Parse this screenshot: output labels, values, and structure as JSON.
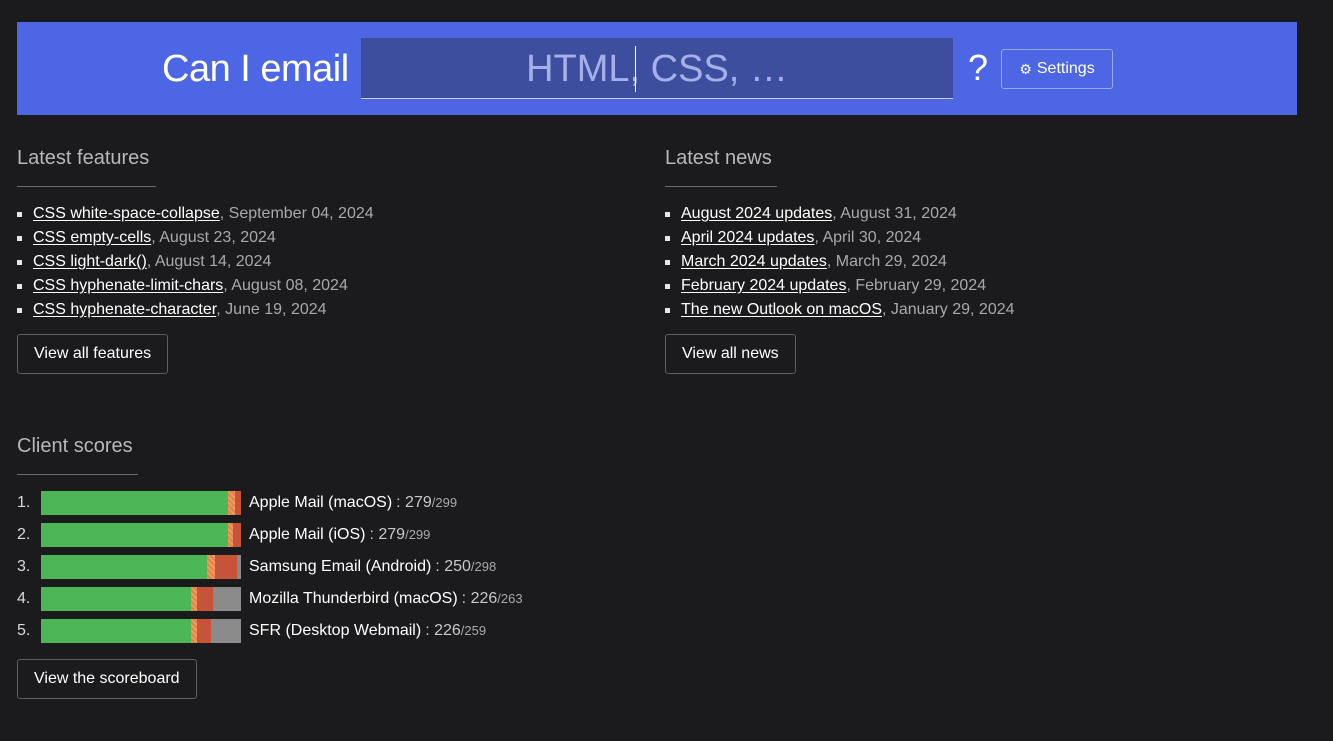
{
  "header": {
    "brand": "Can I email",
    "search_placeholder": "HTML, CSS, …",
    "help_label": "?",
    "settings_label": "Settings"
  },
  "latest_features": {
    "title": "Latest features",
    "items": [
      {
        "link": "CSS white-space-collapse",
        "date": ", September 04, 2024"
      },
      {
        "link": "CSS empty-cells",
        "date": ", August 23, 2024"
      },
      {
        "link": "CSS light-dark()",
        "date": ", August 14, 2024"
      },
      {
        "link": "CSS hyphenate-limit-chars",
        "date": ", August 08, 2024"
      },
      {
        "link": "CSS hyphenate-character",
        "date": ", June 19, 2024"
      }
    ],
    "button": "View all features"
  },
  "latest_news": {
    "title": "Latest news",
    "items": [
      {
        "link": "August 2024 updates",
        "date": ", August 31, 2024"
      },
      {
        "link": "April 2024 updates",
        "date": ", April 30, 2024"
      },
      {
        "link": "March 2024 updates",
        "date": ", March 29, 2024"
      },
      {
        "link": "February 2024 updates",
        "date": ", February 29, 2024"
      },
      {
        "link": "The new Outlook on macOS",
        "date": ", January 29, 2024"
      }
    ],
    "button": "View all news"
  },
  "client_scores": {
    "title": "Client scores",
    "colors": {
      "supported": "#4db657",
      "partial": "#e8a44d",
      "not_supported": "#c8533b",
      "unknown": "#8b8b8b"
    },
    "items": [
      {
        "rank": "1.",
        "name": "Apple Mail (macOS)",
        "separator": " : ",
        "score": "279",
        "total": "/299",
        "segments": {
          "yes": 0.935,
          "partial": 0.035,
          "no": 0.03,
          "unknown": 0
        }
      },
      {
        "rank": "2.",
        "name": "Apple Mail (iOS)",
        "separator": " : ",
        "score": "279",
        "total": "/299",
        "segments": {
          "yes": 0.935,
          "partial": 0.025,
          "no": 0.04,
          "unknown": 0
        }
      },
      {
        "rank": "3.",
        "name": "Samsung Email (Android)",
        "separator": " : ",
        "score": "250",
        "total": "/298",
        "segments": {
          "yes": 0.83,
          "partial": 0.04,
          "no": 0.11,
          "unknown": 0.02
        }
      },
      {
        "rank": "4.",
        "name": "Mozilla Thunderbird (macOS)",
        "separator": " : ",
        "score": "226",
        "total": "/263",
        "segments": {
          "yes": 0.75,
          "partial": 0.03,
          "no": 0.08,
          "unknown": 0.14
        }
      },
      {
        "rank": "5.",
        "name": "SFR (Desktop Webmail)",
        "separator": " : ",
        "score": "226",
        "total": "/259",
        "segments": {
          "yes": 0.75,
          "partial": 0.03,
          "no": 0.07,
          "unknown": 0.15
        }
      }
    ],
    "button": "View the scoreboard"
  }
}
